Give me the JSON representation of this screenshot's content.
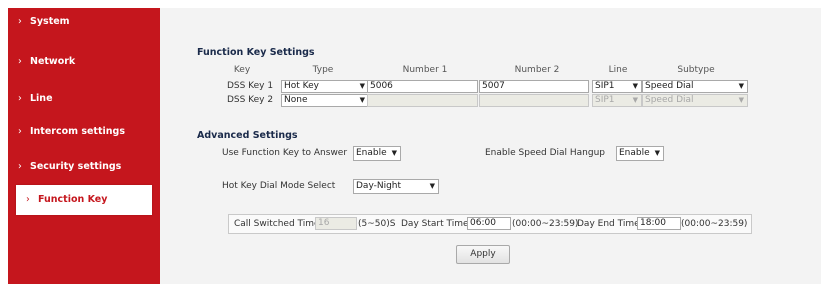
{
  "sidebar": {
    "items": [
      {
        "label": "System"
      },
      {
        "label": "Network"
      },
      {
        "label": "Line"
      },
      {
        "label": "Intercom settings"
      },
      {
        "label": "Security settings"
      },
      {
        "label": "Function Key",
        "active": true
      }
    ],
    "chevron": "›",
    "color": "#c5161d"
  },
  "function_key_settings": {
    "title": "Function Key Settings",
    "columns": [
      "Key",
      "Type",
      "Number 1",
      "Number 2",
      "Line",
      "Subtype"
    ],
    "rows": [
      {
        "key": "DSS Key 1",
        "type": "Hot Key",
        "number1": "5006",
        "number2": "5007",
        "line": "SIP1",
        "subtype": "Speed Dial",
        "disabled": false
      },
      {
        "key": "DSS Key 2",
        "type": "None",
        "number1": "",
        "number2": "",
        "line": "SIP1",
        "subtype": "Speed Dial",
        "disabled": true
      }
    ]
  },
  "advanced_settings": {
    "title": "Advanced Settings",
    "use_fk_answer": {
      "label": "Use Function Key to Answer",
      "value": "Enable"
    },
    "speed_dial_hangup": {
      "label": "Enable Speed Dial Hangup",
      "value": "Enable"
    },
    "hot_key_mode": {
      "label": "Hot Key Dial Mode Select",
      "value": "Day-Night"
    },
    "call_switched_time": {
      "label": "Call Switched Time",
      "value": "16",
      "hint": "(5~50)S"
    },
    "day_start_time": {
      "label": "Day Start Time",
      "value": "06:00",
      "hint": "(00:00~23:59)"
    },
    "day_end_time": {
      "label": "Day End Time",
      "value": "18:00",
      "hint": "(00:00~23:59)"
    },
    "apply_label": "Apply"
  },
  "icons": {
    "dropdown": "▼"
  }
}
